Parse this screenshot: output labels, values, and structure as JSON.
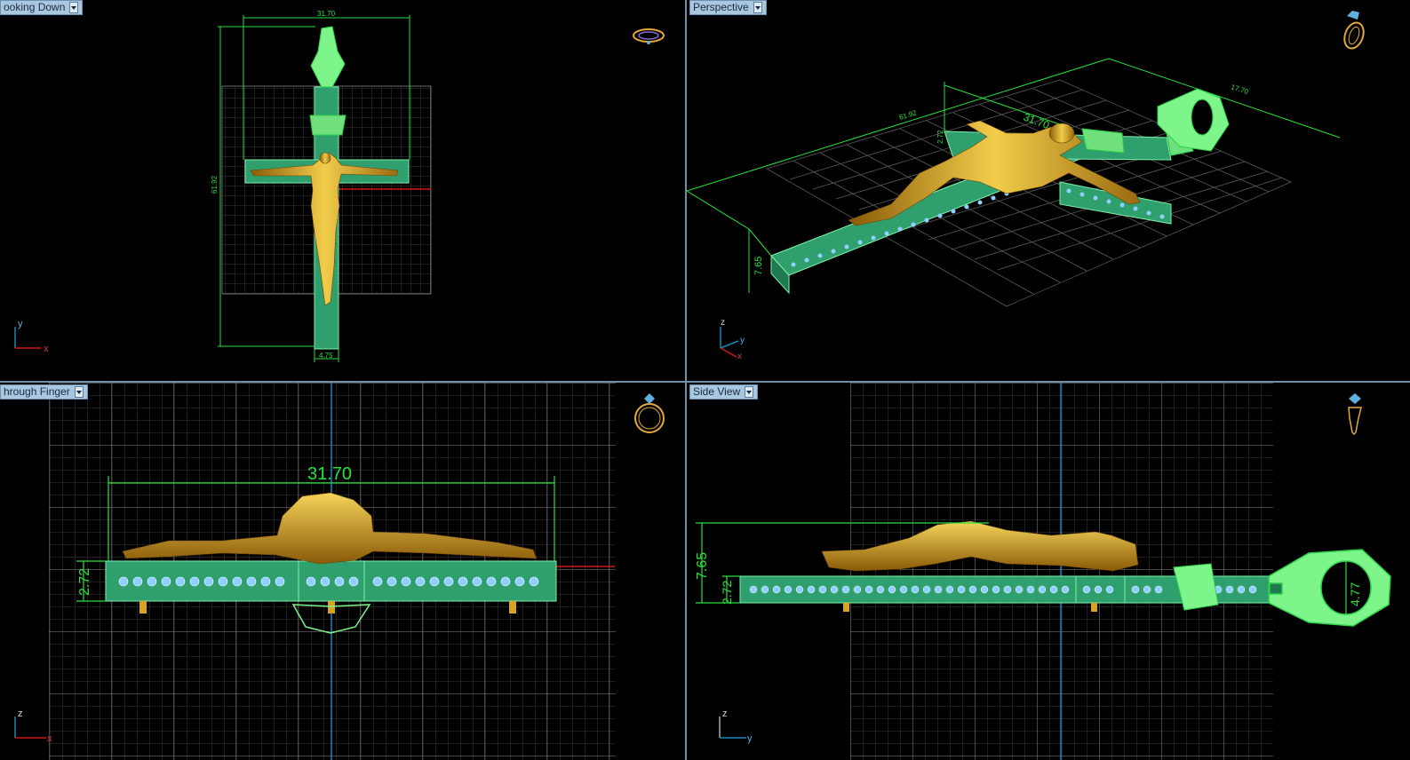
{
  "viewports": {
    "top_left": {
      "label": "ooking Down",
      "dim_width": "31.70",
      "dim_height": "61.92",
      "dim_bottom": "4.75",
      "axis_a": "y",
      "axis_b": "x"
    },
    "top_right": {
      "label": "Perspective",
      "dim_width": "31.70",
      "dim_length": "61.92",
      "dim_bail": "17.70",
      "dim_height": "7.65",
      "dim_small": "2.72",
      "axis_a": "z",
      "axis_b": "y",
      "axis_c": "x"
    },
    "bottom_left": {
      "label": "hrough Finger",
      "dim_width": "31.70",
      "dim_height": "2.72",
      "axis_a": "z",
      "axis_b": "x"
    },
    "bottom_right": {
      "label": "Side View",
      "dim_height": "7.65",
      "dim_small": "2.72",
      "dim_ring": "4.77",
      "axis_a": "z",
      "axis_b": "y"
    }
  },
  "colors": {
    "grid": "#3c3c3c",
    "dimension": "#29e03c",
    "cross": "#2f9f6e",
    "gold": "#e2b22a",
    "gem": "#8fd0ff",
    "label_bg": "#a9c8e0",
    "red_axis": "#d01818",
    "blue_axis": "#1f86b8"
  },
  "icons": {
    "ring_orientation": "ring-icon",
    "dropdown": "chevron-down-icon"
  }
}
